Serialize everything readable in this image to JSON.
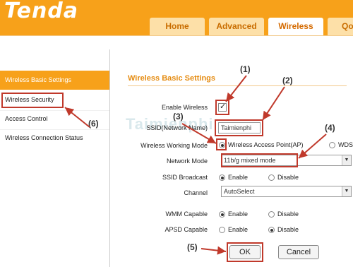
{
  "brand": {
    "logo": "Tenda"
  },
  "tabs": [
    {
      "label": "Home"
    },
    {
      "label": "Advanced"
    },
    {
      "label": "Wireless"
    },
    {
      "label": "Qo"
    }
  ],
  "sidebar": {
    "items": [
      {
        "label": "Wireless Basic Settings"
      },
      {
        "label": "Wireless Security"
      },
      {
        "label": "Access Control"
      },
      {
        "label": "Wireless Connection Status"
      }
    ]
  },
  "content": {
    "title": "Wireless Basic Settings",
    "enable_wireless_label": "Enable Wireless",
    "ssid_label": "SSID(Network Name)",
    "ssid_value": "Taimienphi",
    "working_mode_label": "Wireless Working Mode",
    "working_mode_opt1": "Wireless Access Point(AP)",
    "working_mode_opt2": "WDS",
    "network_mode_label": "Network Mode",
    "network_mode_value": "11b/g mixed mode",
    "ssid_broadcast_label": "SSID Broadcast",
    "channel_label": "Channel",
    "channel_value": "AutoSelect",
    "wmm_label": "WMM Capable",
    "apsd_label": "APSD Capable",
    "enable": "Enable",
    "disable": "Disable",
    "ok": "OK",
    "cancel": "Cancel"
  },
  "annotations": [
    "(1)",
    "(2)",
    "(3)",
    "(4)",
    "(5)",
    "(6)"
  ],
  "watermark": "Taimienphi",
  "colors": {
    "brand_orange": "#f7a11a",
    "annotation_red": "#c0392b"
  }
}
